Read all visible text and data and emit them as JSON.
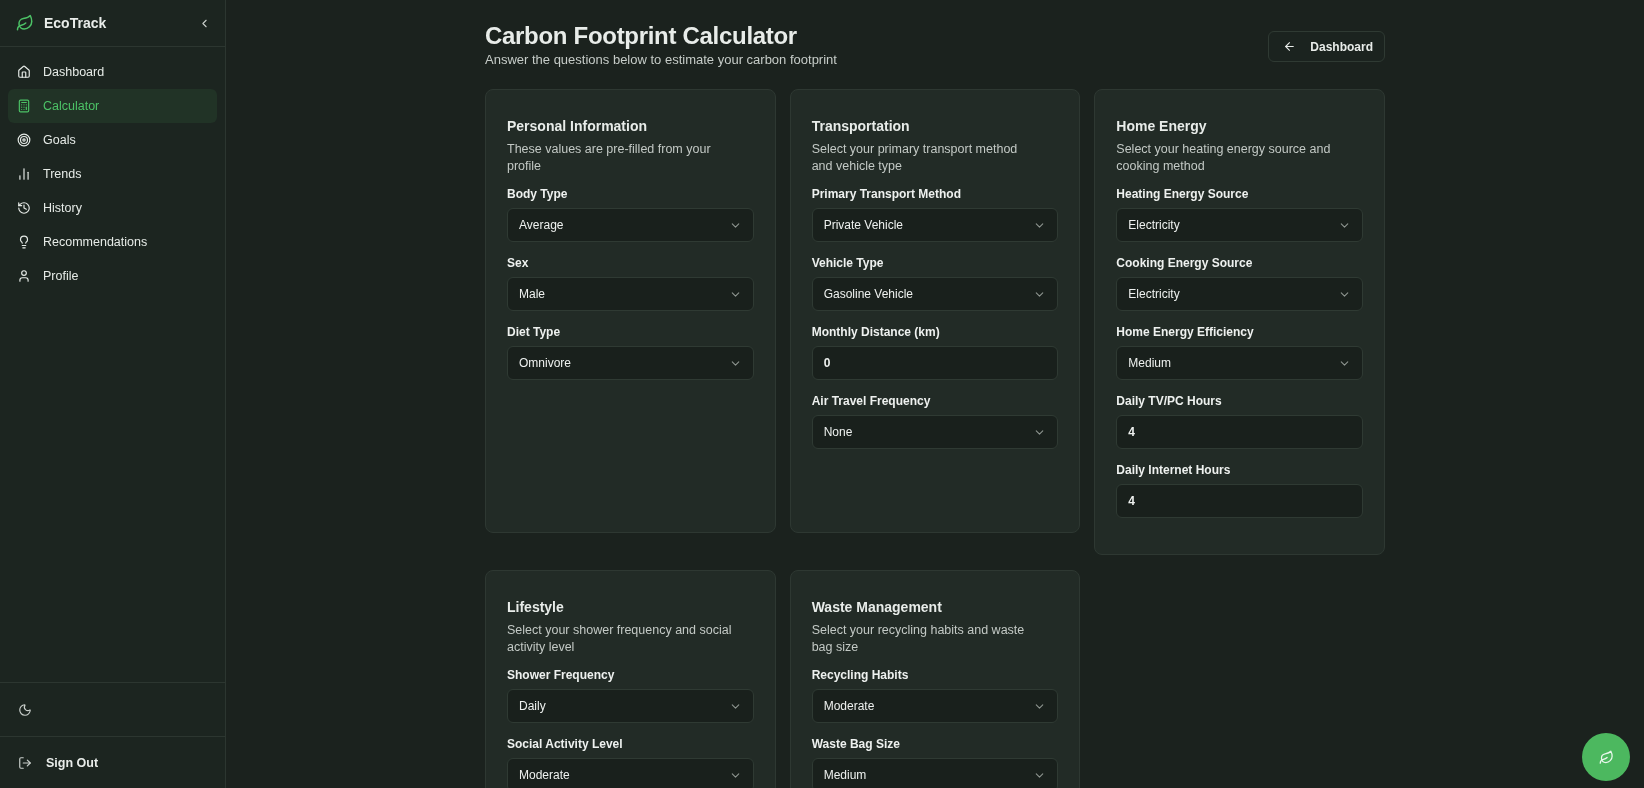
{
  "sidebar": {
    "brand": "EcoTrack",
    "items": [
      {
        "label": "Dashboard",
        "selected": false
      },
      {
        "label": "Calculator",
        "selected": true
      },
      {
        "label": "Goals",
        "selected": false
      },
      {
        "label": "Trends",
        "selected": false
      },
      {
        "label": "History",
        "selected": false
      },
      {
        "label": "Recommendations",
        "selected": false
      },
      {
        "label": "Profile",
        "selected": false
      }
    ],
    "sign_out": "Sign Out"
  },
  "header": {
    "title": "Carbon Footprint Calculator",
    "subtitle": "Answer the questions below to estimate your carbon footprint",
    "back_button": "Dashboard"
  },
  "sections": [
    {
      "title": "Personal Information",
      "description": "These values are pre-filled from your profile",
      "fields": [
        {
          "label": "Body Type",
          "kind": "select",
          "value": "Average"
        },
        {
          "label": "Sex",
          "kind": "select",
          "value": "Male"
        },
        {
          "label": "Diet Type",
          "kind": "select",
          "value": "Omnivore"
        }
      ]
    },
    {
      "title": "Transportation",
      "description": "Select your primary transport method and vehicle type",
      "fields": [
        {
          "label": "Primary Transport Method",
          "kind": "select",
          "value": "Private Vehicle"
        },
        {
          "label": "Vehicle Type",
          "kind": "select",
          "value": "Gasoline Vehicle"
        },
        {
          "label": "Monthly Distance (km)",
          "kind": "number",
          "value": "0"
        },
        {
          "label": "Air Travel Frequency",
          "kind": "select",
          "value": "None"
        }
      ]
    },
    {
      "title": "Home Energy",
      "description": "Select your heating energy source and cooking method",
      "fields": [
        {
          "label": "Heating Energy Source",
          "kind": "select",
          "value": "Electricity"
        },
        {
          "label": "Cooking Energy Source",
          "kind": "select",
          "value": "Electricity"
        },
        {
          "label": "Home Energy Efficiency",
          "kind": "select",
          "value": "Medium"
        },
        {
          "label": "Daily TV/PC Hours",
          "kind": "number",
          "value": "4"
        },
        {
          "label": "Daily Internet Hours",
          "kind": "number",
          "value": "4"
        }
      ]
    },
    {
      "title": "Lifestyle",
      "description": "Select your shower frequency and social activity level",
      "fields": [
        {
          "label": "Shower Frequency",
          "kind": "select",
          "value": "Daily"
        },
        {
          "label": "Social Activity Level",
          "kind": "select",
          "value": "Moderate"
        }
      ]
    },
    {
      "title": "Waste Management",
      "description": "Select your recycling habits and waste bag size",
      "fields": [
        {
          "label": "Recycling Habits",
          "kind": "select",
          "value": "Moderate"
        },
        {
          "label": "Waste Bag Size",
          "kind": "select",
          "value": "Medium"
        }
      ]
    }
  ]
}
